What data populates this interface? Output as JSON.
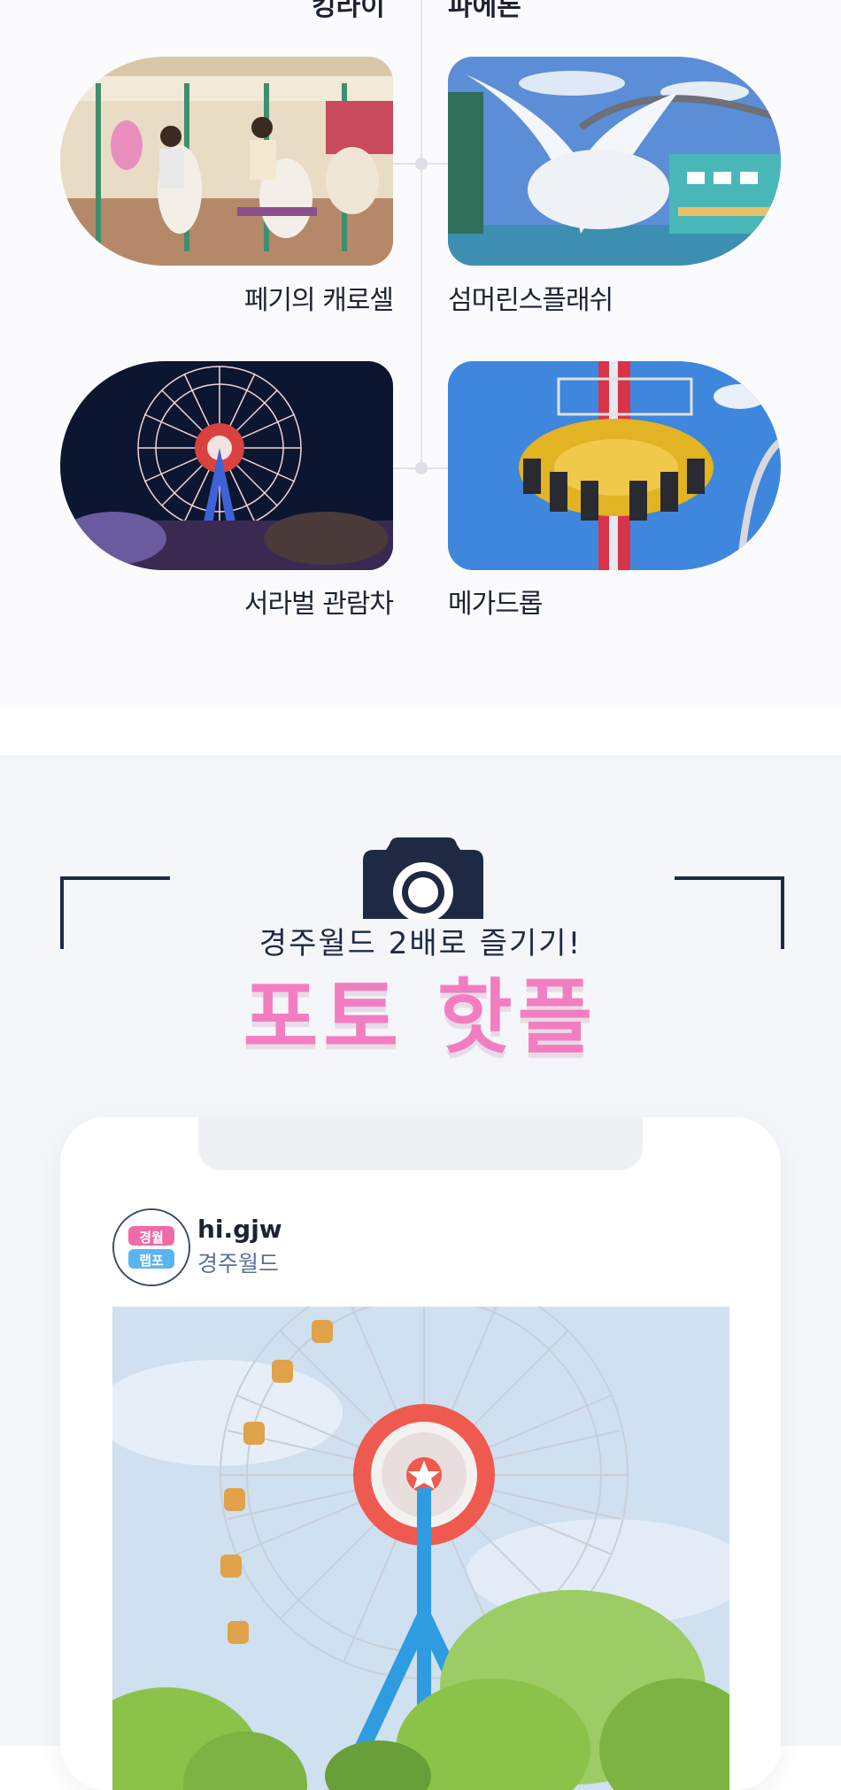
{
  "rides": {
    "cut_left_label": "킹라이",
    "cut_right_label": "파에톤",
    "items": [
      {
        "label": "페기의 캐로셀",
        "image": "carousel-photo"
      },
      {
        "label": "섬머린스플래쉬",
        "image": "water-splash-photo"
      },
      {
        "label": "서라벌 관람차",
        "image": "ferris-wheel-night-photo"
      },
      {
        "label": "메가드롭",
        "image": "drop-tower-photo"
      }
    ]
  },
  "photo_section": {
    "subtitle": "경주월드 2배로 즐기기!",
    "title": "포토 핫플",
    "icon": "camera-icon",
    "accent_color": "#f27ec1",
    "dark_color": "#1e2a44"
  },
  "post": {
    "username": "hi.gjw",
    "location": "경주월드",
    "avatar_text": "경월 랩포",
    "image": "ferris-wheel-day-photo"
  }
}
